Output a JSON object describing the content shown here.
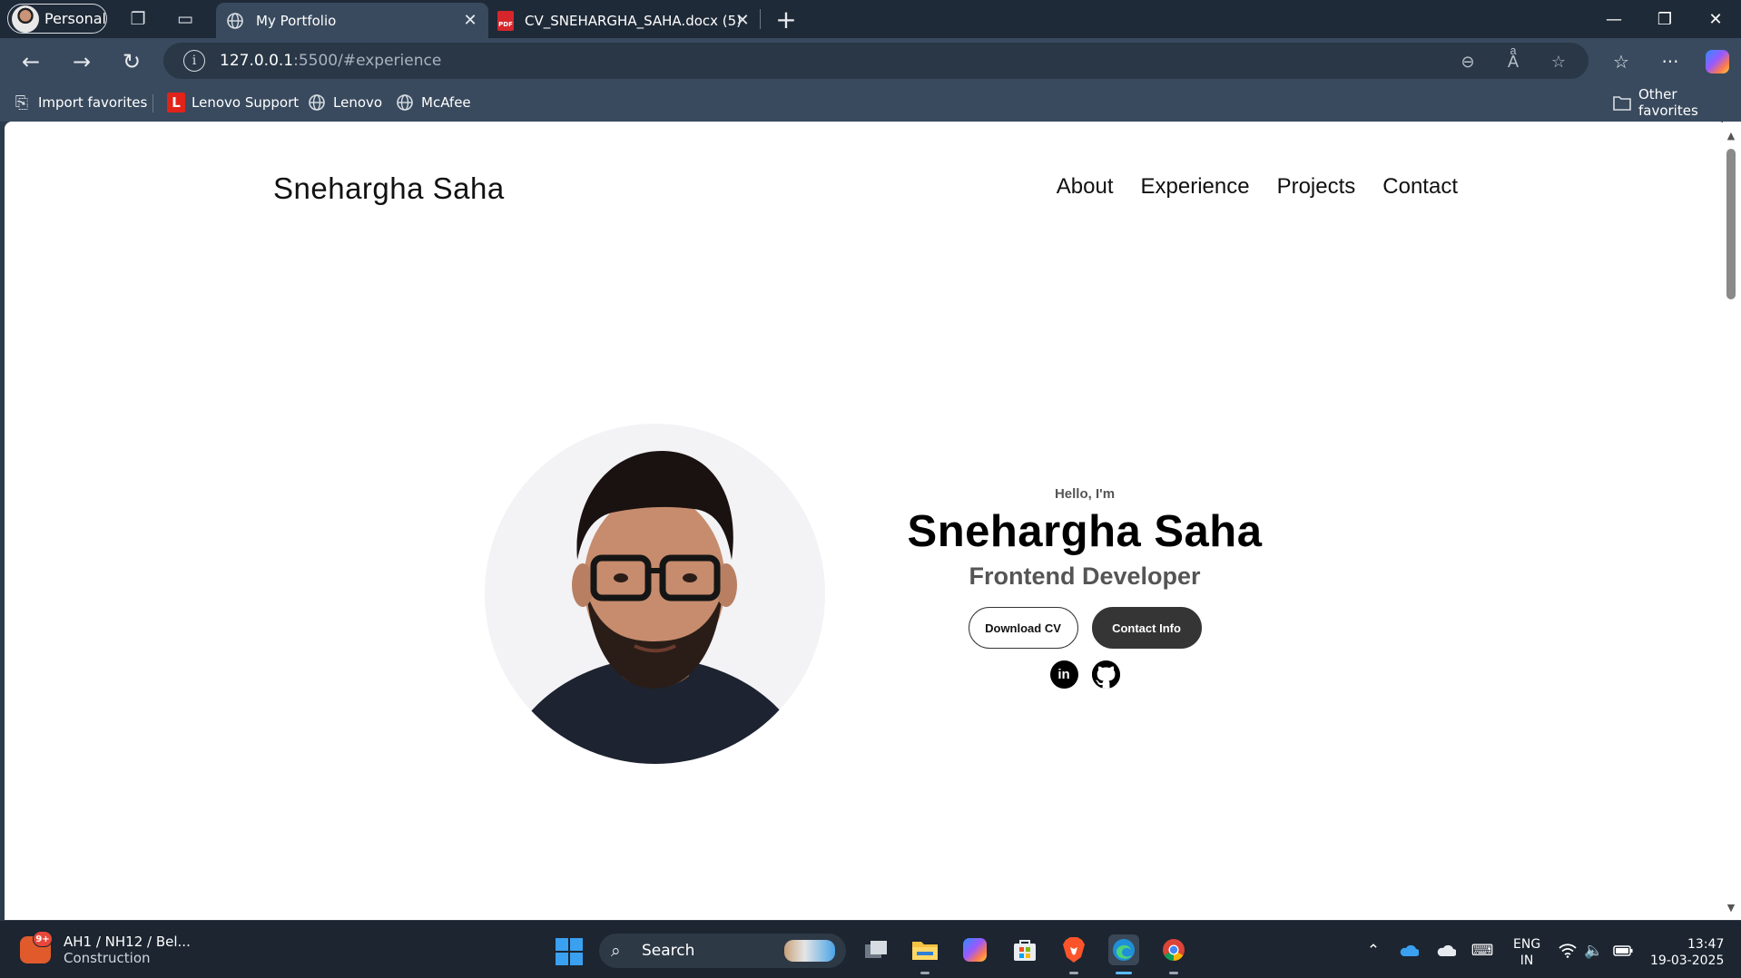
{
  "browser": {
    "profile_label": "Personal",
    "tabs": [
      {
        "title": "My Portfolio",
        "active": true,
        "icon": "globe-icon"
      },
      {
        "title": "CV_SNEHARGHA_SAHA.docx (5)",
        "active": false,
        "icon": "pdf-icon"
      }
    ],
    "pdf_badge": "PDF",
    "address": {
      "host": "127.0.0.1",
      "path": ":5500/#experience"
    },
    "favorites": [
      {
        "label": "Import favorites",
        "icon": "import-icon"
      },
      {
        "label": "Lenovo Support",
        "icon": "lenovo-icon",
        "badge": "L"
      },
      {
        "label": "Lenovo",
        "icon": "globe-icon"
      },
      {
        "label": "McAfee",
        "icon": "globe-icon"
      }
    ],
    "other_favorites": "Other favorites"
  },
  "page": {
    "logo": "Snehargha Saha",
    "nav": [
      "About",
      "Experience",
      "Projects",
      "Contact"
    ],
    "hero": {
      "greeting": "Hello, I'm",
      "name": "Snehargha Saha",
      "role": "Frontend Developer",
      "buttons": {
        "download": "Download CV",
        "contact": "Contact Info"
      },
      "socials": [
        {
          "name": "linkedin-icon",
          "glyph": "in"
        },
        {
          "name": "github-icon"
        }
      ]
    }
  },
  "taskbar": {
    "weather": {
      "badge": "9+",
      "title": "AH1 / NH12 / Bel...",
      "subtitle": "Construction"
    },
    "search_placeholder": "Search",
    "language": {
      "line1": "ENG",
      "line2": "IN"
    },
    "clock": {
      "time": "13:47",
      "date": "19-03-2025"
    }
  },
  "colors": {
    "titlebar": "#1f2a38",
    "toolbar": "#394a5e",
    "button_dark": "#353535",
    "accent": "#3aa0f0"
  }
}
